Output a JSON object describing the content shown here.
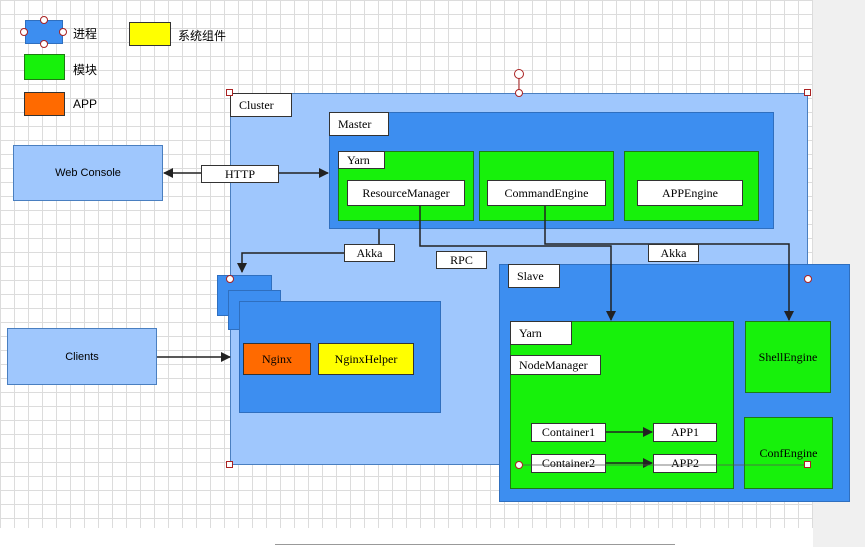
{
  "legend": [
    {
      "label": "进程",
      "color": "#3d8ef0"
    },
    {
      "label": "系统组件",
      "color": "#ffff00"
    },
    {
      "label": "模块",
      "color": "#17f10b"
    },
    {
      "label": "APP",
      "color": "#ff6a00"
    }
  ],
  "nodes": {
    "web_console": "Web Console",
    "clients": "Clients",
    "cluster": "Cluster",
    "master": "Master",
    "master_yarn": "Yarn",
    "resource_manager": "ResourceManager",
    "command_engine": "CommandEngine",
    "app_engine": "APPEngine",
    "nginx": "Nginx",
    "nginx_helper": "NginxHelper",
    "slave": "Slave",
    "slave_yarn": "Yarn",
    "node_manager": "NodeManager",
    "container1": "Container1",
    "container2": "Container2",
    "app1": "APP1",
    "app2": "APP2",
    "shell_engine": "ShellEngine",
    "conf_engine": "ConfEngine"
  },
  "edge_labels": {
    "http": "HTTP",
    "akka_left": "Akka",
    "rpc": "RPC",
    "akka_right": "Akka"
  },
  "colors": {
    "process": "#3d8ef0",
    "process_light": "#9fc7fd",
    "module": "#17f10b",
    "component": "#ffff00",
    "app": "#ff6a00"
  }
}
